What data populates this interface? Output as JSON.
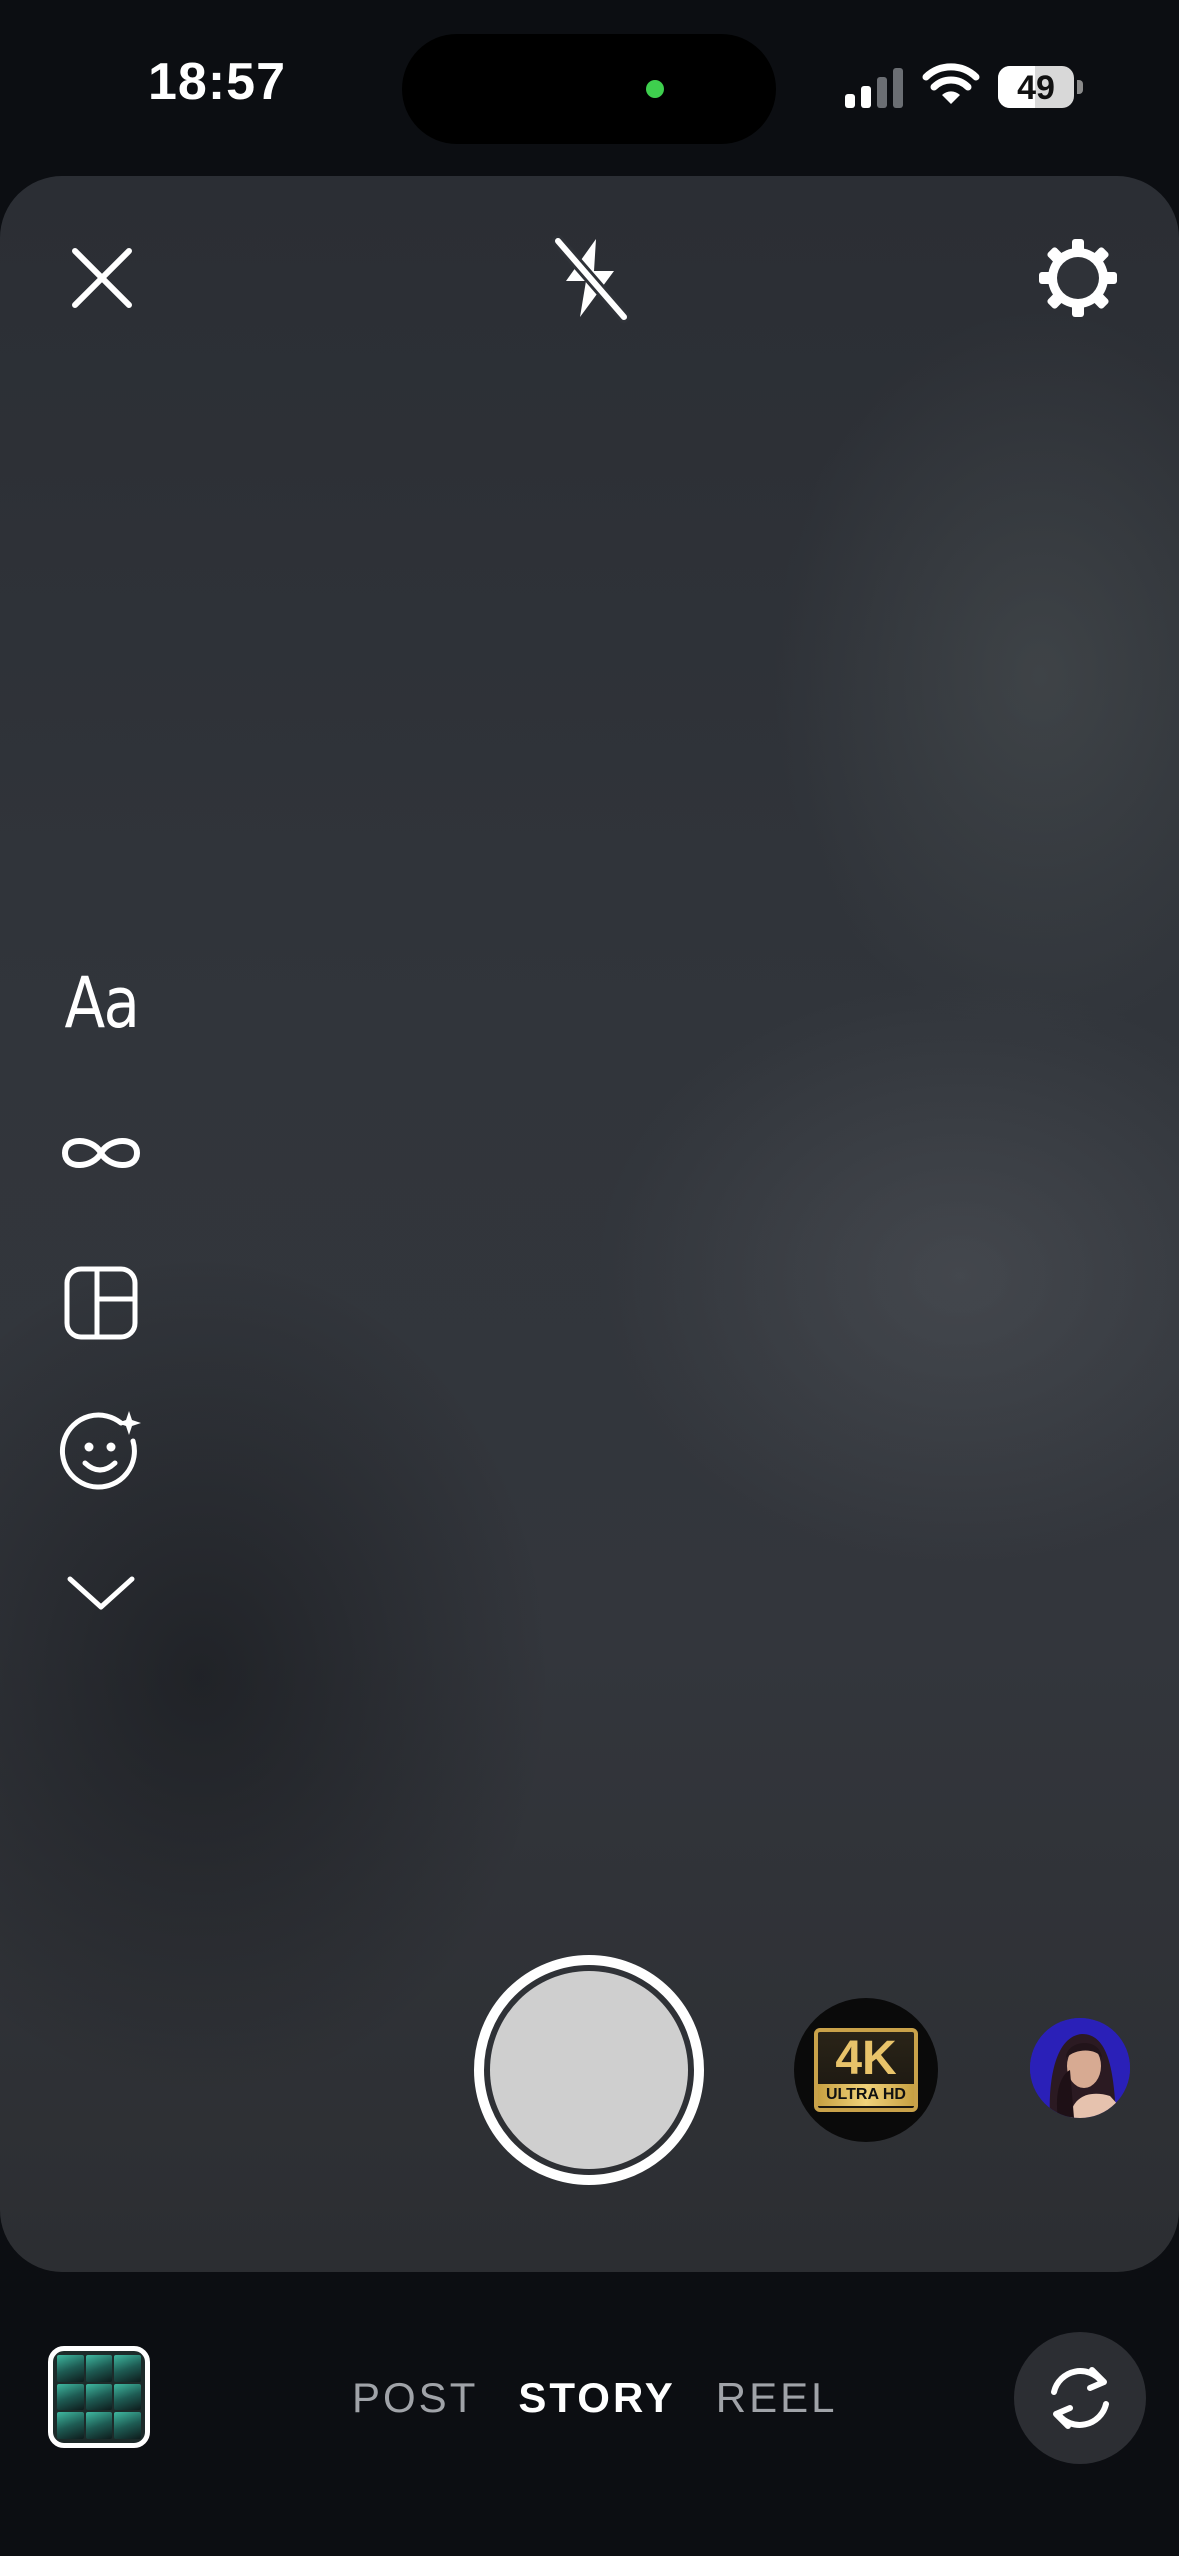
{
  "status_bar": {
    "time": "18:57",
    "battery_percent": "49",
    "battery_level": 0.49,
    "signal_bars_active": 2,
    "signal_bars_total": 4
  },
  "camera": {
    "top_controls": {
      "close_icon": "close-icon",
      "flash_icon": "flash-off-icon",
      "settings_icon": "gear-icon"
    },
    "side_tools": [
      {
        "name": "create-text-tool",
        "label": "Aa",
        "icon": "text-icon"
      },
      {
        "name": "boomerang-tool",
        "label": "",
        "icon": "infinity-icon"
      },
      {
        "name": "layout-tool",
        "label": "",
        "icon": "layout-icon"
      },
      {
        "name": "ar-effects-tool",
        "label": "",
        "icon": "smile-sparkle-icon"
      },
      {
        "name": "more-tools",
        "label": "",
        "icon": "chevron-down-icon"
      }
    ],
    "effects": {
      "effect_4k_main": "4K",
      "effect_4k_sub": "ULTRA HD"
    }
  },
  "bottom_bar": {
    "modes": [
      {
        "label": "POST",
        "active": false
      },
      {
        "label": "STORY",
        "active": true
      },
      {
        "label": "REEL",
        "active": false
      }
    ],
    "gallery_icon": "gallery-thumbnail",
    "flip_icon": "flip-camera-icon"
  },
  "colors": {
    "background": "#0c0e12",
    "viewfinder": "#31353b",
    "shutter_fill": "#cfcfcf",
    "island_dot": "#3ecf4e",
    "gold": "#c9a24a"
  }
}
